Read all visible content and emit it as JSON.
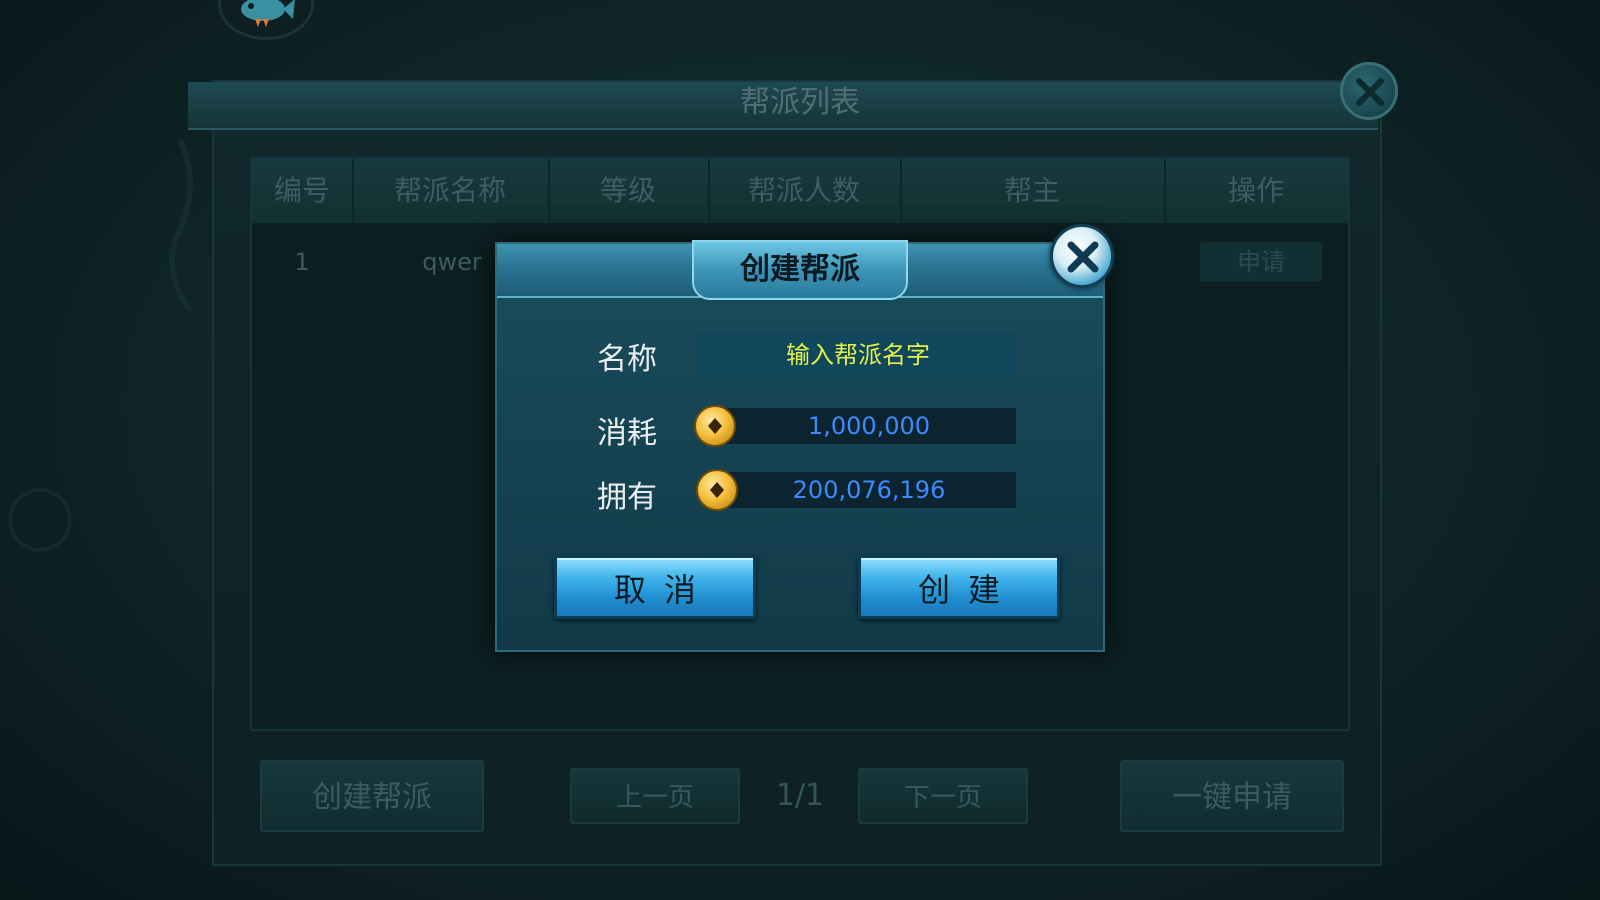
{
  "main_panel": {
    "title": "帮派列表",
    "columns": [
      "编号",
      "帮派名称",
      "等级",
      "帮派人数",
      "帮主",
      "操作"
    ],
    "rows": [
      {
        "id": "1",
        "name": "qwer",
        "action": "申请"
      }
    ],
    "buttons": {
      "create_guild": "创建帮派",
      "prev_page": "上一页",
      "page_indicator": "1/1",
      "next_page": "下一页",
      "one_click_apply": "一键申请"
    }
  },
  "dialog": {
    "title": "创建帮派",
    "name_label": "名称",
    "name_placeholder": "输入帮派名字",
    "cost_label": "消耗",
    "cost_value": "1,000,000",
    "owned_label": "拥有",
    "owned_value": "200,076,196",
    "cancel_label": "取消",
    "create_label": "创建"
  },
  "icons": {
    "currency": "coin-icon",
    "close": "close-icon",
    "avatar": "fish-avatar-icon"
  },
  "colors": {
    "dialog_accent": "#3fb2ea",
    "value_text": "#3b8bff",
    "placeholder_text": "#e6f04a"
  }
}
